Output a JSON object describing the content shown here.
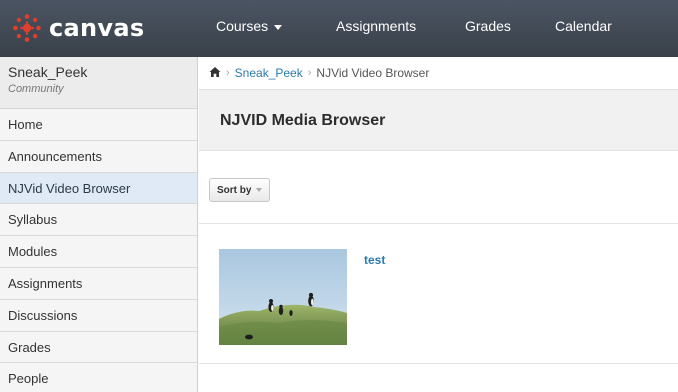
{
  "app": {
    "logo_text": "canvas",
    "logo_icon": "canvas-logo-icon",
    "brand_color": "#e13f2b"
  },
  "topnav": {
    "courses": "Courses",
    "assignments": "Assignments",
    "grades": "Grades",
    "calendar": "Calendar"
  },
  "course": {
    "name": "Sneak_Peek",
    "subtitle": "Community"
  },
  "sidebar": {
    "items": [
      {
        "label": "Home"
      },
      {
        "label": "Announcements"
      },
      {
        "label": "NJVid Video Browser"
      },
      {
        "label": "Syllabus"
      },
      {
        "label": "Modules"
      },
      {
        "label": "Assignments"
      },
      {
        "label": "Discussions"
      },
      {
        "label": "Grades"
      },
      {
        "label": "People"
      }
    ],
    "active_index": 2
  },
  "breadcrumb": {
    "home_icon": "home-icon",
    "course": "Sneak_Peek",
    "current": "NJVid Video Browser"
  },
  "page": {
    "title": "NJVID Media Browser",
    "sort_label": "Sort by"
  },
  "media": [
    {
      "title": "test",
      "thumbnail": "puffins-on-grassy-hill"
    }
  ],
  "colors": {
    "topbar": "#3d444d",
    "link": "#2a7ab0",
    "sidebar_active": "#dfeaf6"
  }
}
